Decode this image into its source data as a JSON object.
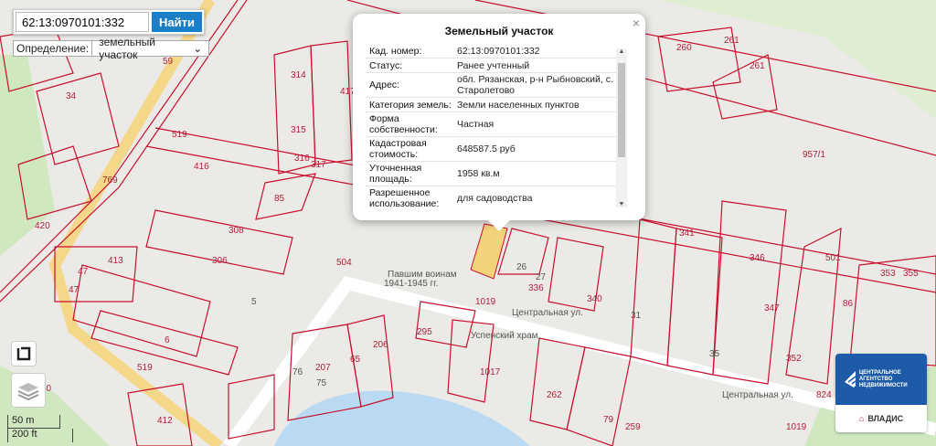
{
  "search": {
    "value": "62:13:0970101:332",
    "button_label": "Найти"
  },
  "definition": {
    "label": "Определение:",
    "selected": "земельный участок"
  },
  "scale": {
    "metric": "50 m",
    "imperial": "200 ft"
  },
  "popup": {
    "title": "Земельный участок",
    "rows": [
      {
        "key": "Кад. номер:",
        "value": "62:13:0970101:332"
      },
      {
        "key": "Статус:",
        "value": "Ранее учтенный"
      },
      {
        "key": "Адрес:",
        "value": "обл. Рязанская, р-н Рыбновский, с. Старолетово"
      },
      {
        "key": "Категория земель:",
        "value": "Земли населенных пунктов"
      },
      {
        "key": "Форма собственности:",
        "value": "Частная"
      },
      {
        "key": "Кадастровая стоимость:",
        "value": "648587.5 руб"
      },
      {
        "key": "Уточненная площадь:",
        "value": "1958 кв.м"
      },
      {
        "key": "Разрешенное использование:",
        "value": "для садоводства"
      }
    ]
  },
  "logo": {
    "name": "ЦЕНТРАЛЬНОЕ АГЕНТСТВО НЕДВИЖИМОСТИ",
    "brand": "ВЛАДИС",
    "color": "#1d5ba8"
  },
  "map_labels": [
    "59",
    "34",
    "314",
    "417",
    "315",
    "316",
    "317",
    "769",
    "519",
    "416",
    "85",
    "420",
    "308",
    "413",
    "306",
    "47",
    "47",
    "5",
    "6",
    "504",
    "1019",
    "Центральная ул.",
    "295",
    "206",
    "207",
    "65",
    "1017",
    "262",
    "79",
    "259",
    "412",
    "10",
    "76",
    "75",
    "336",
    "340",
    "341",
    "346",
    "347",
    "352",
    "501",
    "353",
    "355",
    "86",
    "260",
    "261",
    "261",
    "957/1",
    "Павшим воинам",
    "1941-1945 гг.",
    "Успенский храм",
    "Центральная ул.",
    "1019",
    "824",
    "519",
    "35",
    "31",
    "26",
    "27"
  ],
  "colors": {
    "parcel": "#c8102e",
    "road": "#f5d78a",
    "water": "#b9daf2",
    "green": "#cfe8c0",
    "selected_parcel": "#f2d27a"
  }
}
